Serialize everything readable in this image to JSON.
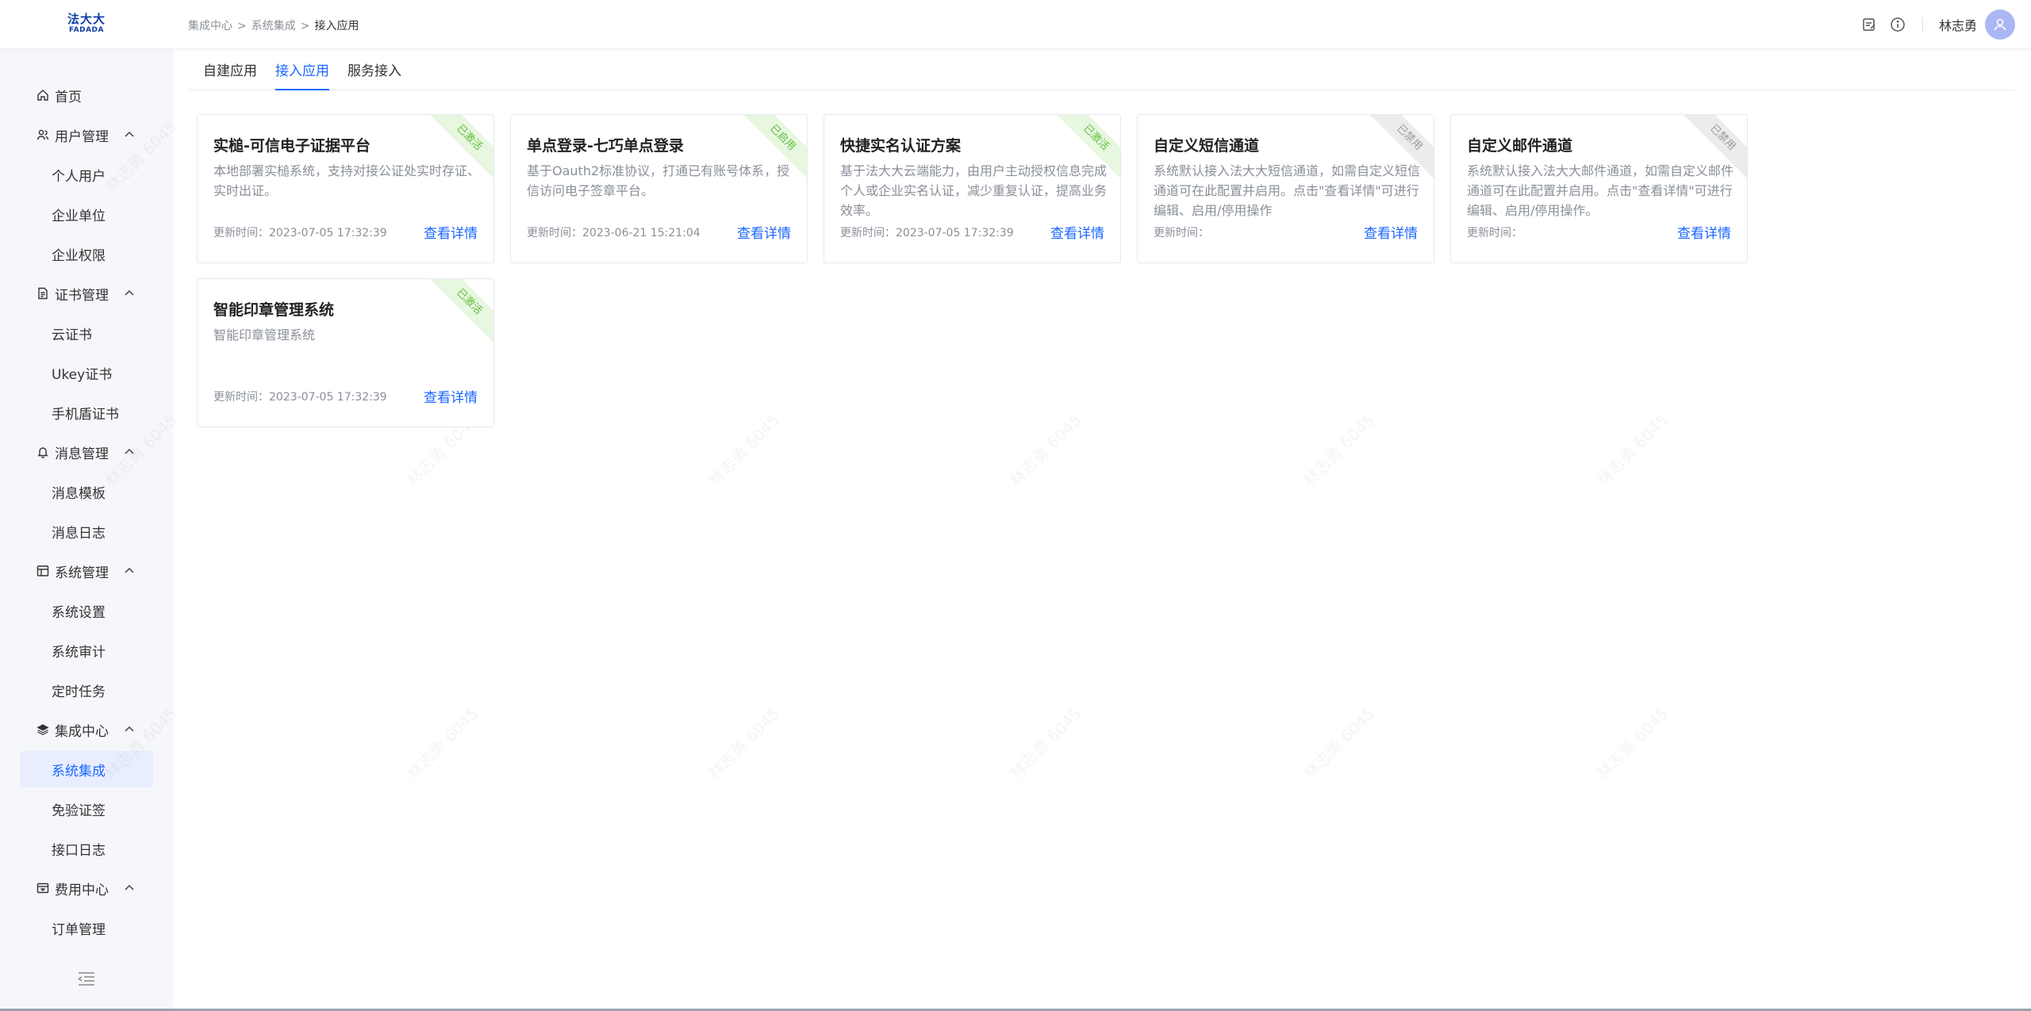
{
  "app": {
    "logo_cn": "法大大",
    "logo_en": "FADADA"
  },
  "header": {
    "breadcrumb": [
      "集成中心",
      "系统集成",
      "接入应用"
    ],
    "breadcrumb_sep": ">",
    "user_name": "林志勇"
  },
  "sidebar": {
    "items": [
      {
        "label": "首页",
        "level": "top",
        "icon": "home-icon"
      },
      {
        "label": "用户管理",
        "level": "top",
        "icon": "user-icon",
        "expanded": true
      },
      {
        "label": "个人用户",
        "level": "child"
      },
      {
        "label": "企业单位",
        "level": "child"
      },
      {
        "label": "企业权限",
        "level": "child"
      },
      {
        "label": "证书管理",
        "level": "top",
        "icon": "certificate-icon",
        "expanded": true
      },
      {
        "label": "云证书",
        "level": "child"
      },
      {
        "label": "Ukey证书",
        "level": "child"
      },
      {
        "label": "手机盾证书",
        "level": "child"
      },
      {
        "label": "消息管理",
        "level": "top",
        "icon": "bell-icon",
        "expanded": true
      },
      {
        "label": "消息模板",
        "level": "child"
      },
      {
        "label": "消息日志",
        "level": "child"
      },
      {
        "label": "系统管理",
        "level": "top",
        "icon": "system-icon",
        "expanded": true
      },
      {
        "label": "系统设置",
        "level": "child"
      },
      {
        "label": "系统审计",
        "level": "child"
      },
      {
        "label": "定时任务",
        "level": "child"
      },
      {
        "label": "集成中心",
        "level": "top",
        "icon": "layers-icon",
        "expanded": true
      },
      {
        "label": "系统集成",
        "level": "child",
        "active": true
      },
      {
        "label": "免验证签",
        "level": "child"
      },
      {
        "label": "接口日志",
        "level": "child"
      },
      {
        "label": "费用中心",
        "level": "top",
        "icon": "billing-icon",
        "expanded": true
      },
      {
        "label": "订单管理",
        "level": "child"
      }
    ]
  },
  "tabs": [
    {
      "label": "自建应用",
      "active": false
    },
    {
      "label": "接入应用",
      "active": true
    },
    {
      "label": "服务接入",
      "active": false
    }
  ],
  "cards": [
    {
      "title": "实槌-可信电子证据平台",
      "desc": "本地部署实槌系统，支持对接公证处实时存证、实时出证。",
      "time": "更新时间：2023-07-05 17:32:39",
      "detail": "查看详情",
      "status": "已激活",
      "status_color": "#5fbf3a"
    },
    {
      "title": "单点登录-七巧单点登录",
      "desc": "基于Oauth2标准协议，打通已有账号体系，授信访问电子签章平台。",
      "time": "更新时间：2023-06-21 15:21:04",
      "detail": "查看详情",
      "status": "已启用",
      "status_color": "#5fbf3a"
    },
    {
      "title": "快捷实名认证方案",
      "desc": "基于法大大云端能力，由用户主动授权信息完成个人或企业实名认证，减少重复认证，提高业务效率。",
      "time": "更新时间：2023-07-05 17:32:39",
      "detail": "查看详情",
      "status": "已激活",
      "status_color": "#5fbf3a"
    },
    {
      "title": "自定义短信通道",
      "desc": "系统默认接入法大大短信通道，如需自定义短信通道可在此配置并启用。点击\"查看详情\"可进行编辑、启用/停用操作",
      "time": "更新时间：",
      "detail": "查看详情",
      "status": "已禁用",
      "status_color": "#9a9a9a"
    },
    {
      "title": "自定义邮件通道",
      "desc": "系统默认接入法大大邮件通道，如需自定义邮件通道可在此配置并启用。点击\"查看详情\"可进行编辑、启用/停用操作。",
      "time": "更新时间：",
      "detail": "查看详情",
      "status": "已禁用",
      "status_color": "#9a9a9a"
    },
    {
      "title": "智能印章管理系统",
      "desc": "智能印章管理系统",
      "time": "更新时间：2023-07-05 17:32:39",
      "detail": "查看详情",
      "status": "已激活",
      "status_color": "#5fbf3a"
    }
  ],
  "watermark": "林志勇 6045",
  "colors": {
    "accent": "#1a66ff",
    "active_green": "#5fbf3a",
    "disabled_grey": "#9a9a9a"
  }
}
